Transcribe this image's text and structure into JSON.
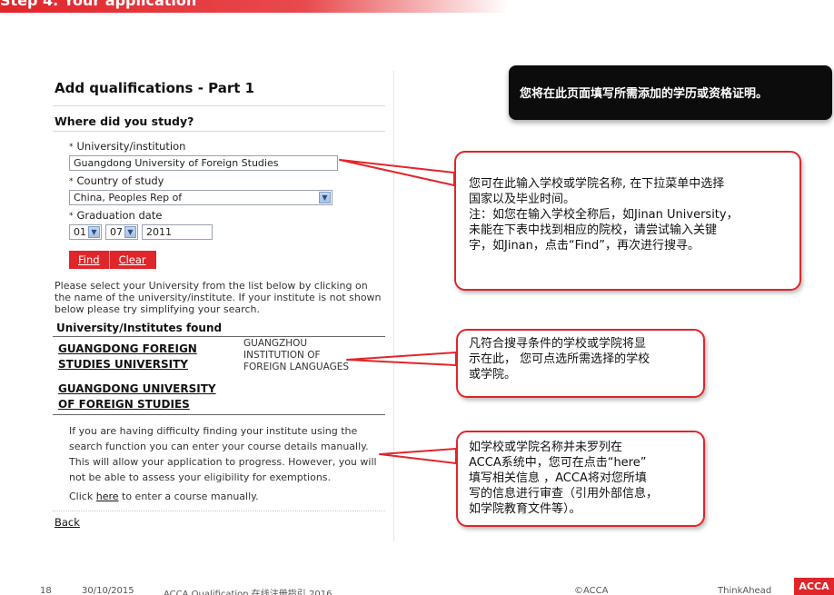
{
  "banner": {
    "text": "Step 4. Your application"
  },
  "panel": {
    "title": "Add qualifications - Part 1",
    "section_heading": "Where did you study?",
    "university_label": "University/institution",
    "university_value": "Guangdong University of Foreign Studies",
    "country_label": "Country of study",
    "country_value": "China, Peoples Rep of",
    "graduation_label": "Graduation date",
    "grad_day": "01",
    "grad_month": "07",
    "grad_year": "2011",
    "required_marker": "*",
    "find_label": "Find",
    "clear_label": "Clear",
    "instructions": "Please select your University from the list below by clicking on the name of the university/institute. If your institute is not shown below please try simplifying your search.",
    "found_heading": "University/Institutes found",
    "results": [
      {
        "line1": "GUANGDONG FOREIGN",
        "line2": "STUDIES UNIVERSITY"
      },
      {
        "line1": "GUANGDONG UNIVERSITY",
        "line2": "OF FOREIGN STUDIES"
      }
    ],
    "alt_result": {
      "line1": "GUANGZHOU",
      "line2": "INSTITUTION OF",
      "line3": "FOREIGN LANGUAGES"
    },
    "difficulty": "If you are having difficulty finding your institute using the search function you can enter your course details manually. This will allow your application to progress. However, you will not be able to assess your eligibility for exemptions.",
    "manual_prefix": "Click ",
    "manual_link": "here",
    "manual_suffix": " to enter a course manually.",
    "back_label": "Back"
  },
  "callouts": {
    "top": "您将在此页面填写所需添加的学历或资格证明。",
    "search": {
      "l1": "您可在此输入学校或学院名称, 在下拉菜单中选择",
      "l2": "国家以及毕业时间。",
      "l3": "注：如您在输入学校全称后，如Jinan University，",
      "l4": "未能在下表中找到相应的院校，请尝试输入关键",
      "l5": "字，如Jinan，点击“Find”，再次进行搜寻。"
    },
    "results": {
      "l1": "凡符合搜寻条件的学校或学院将显",
      "l2": "示在此， 您可点选所需选择的学校",
      "l3": "或学院。"
    },
    "manual": {
      "l1": "如学校或学院名称并未罗列在",
      "l2": "ACCA系统中，您可在点击“here”",
      "l3": "填写相关信息 ，ACCA将对您所填",
      "l4": "写的信息进行审查（引用外部信息，",
      "l5": "如学院教育文件等）。"
    }
  },
  "footer": {
    "page": "18",
    "date": "30/10/2015",
    "doc": "ACCA Qualification 在线注册指引 2016",
    "org": "©ACCA",
    "right": "ThinkAhead",
    "logo": "ACCA"
  },
  "colors": {
    "accent": "#e0262b",
    "callout_bg": "#0c0c0c"
  }
}
